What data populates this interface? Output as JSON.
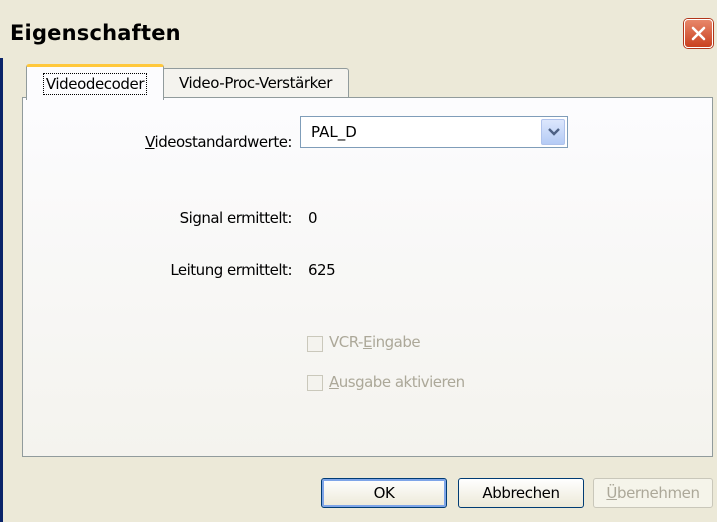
{
  "window": {
    "title": "Eigenschaften",
    "close_icon": "close-icon"
  },
  "tabs": [
    {
      "label": "Videodecoder",
      "active": true
    },
    {
      "label": "Video-Proc-Verstärker",
      "active": false
    }
  ],
  "form": {
    "video_standard": {
      "label": "Videostandardwerte:",
      "accesskey": "V",
      "value": "PAL_D"
    },
    "signal": {
      "label": "Signal ermittelt:",
      "value": "0"
    },
    "lines": {
      "label": "Leitung ermittelt:",
      "value": "625"
    },
    "vcr_input": {
      "label": "VCR-Eingabe",
      "checked": false,
      "enabled": false
    },
    "enable_output": {
      "label": "Ausgabe aktivieren",
      "checked": false,
      "enabled": false
    }
  },
  "buttons": {
    "ok": "OK",
    "cancel": "Abbrechen",
    "apply": "Übernehmen"
  }
}
